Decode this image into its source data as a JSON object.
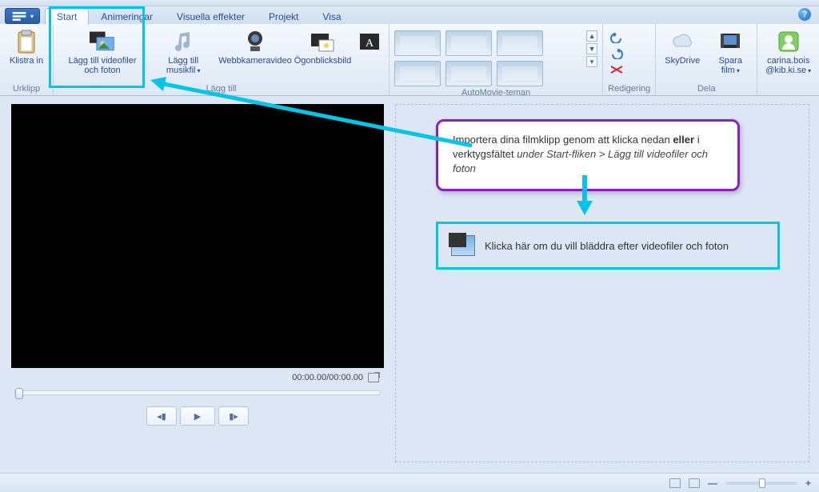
{
  "tabs": {
    "start": "Start",
    "animations": "Animeringar",
    "effects": "Visuella effekter",
    "project": "Projekt",
    "view": "Visa"
  },
  "ribbon": {
    "clipboard": {
      "paste": "Klistra in",
      "caption": "Urklipp"
    },
    "add": {
      "add_media": "Lägg till videofiler och foton",
      "add_music": "Lägg till musikfil",
      "webcam": "Webbkameravideo",
      "snapshot": "Ögonblicksbild",
      "caption": "Lägg till"
    },
    "themes_caption": "AutoMovie-teman",
    "editing_caption": "Redigering",
    "share": {
      "skydrive": "SkyDrive",
      "save": "Spara film",
      "caption": "Dela"
    },
    "account": {
      "line1": "carina.bois",
      "line2": "@kib.ki.se"
    }
  },
  "preview": {
    "time": "00:00.00/00:00.00"
  },
  "callout": {
    "pre": "Importera dina filmklipp genom att klicka nedan ",
    "bold": "eller",
    "mid": " i verktygsfältet ",
    "italic": "under Start-fliken > Lägg till videofiler och foton"
  },
  "browse_text": "Klicka här om du vill bläddra efter videofiler och foton",
  "status": {
    "minus": "—",
    "plus": "+"
  }
}
